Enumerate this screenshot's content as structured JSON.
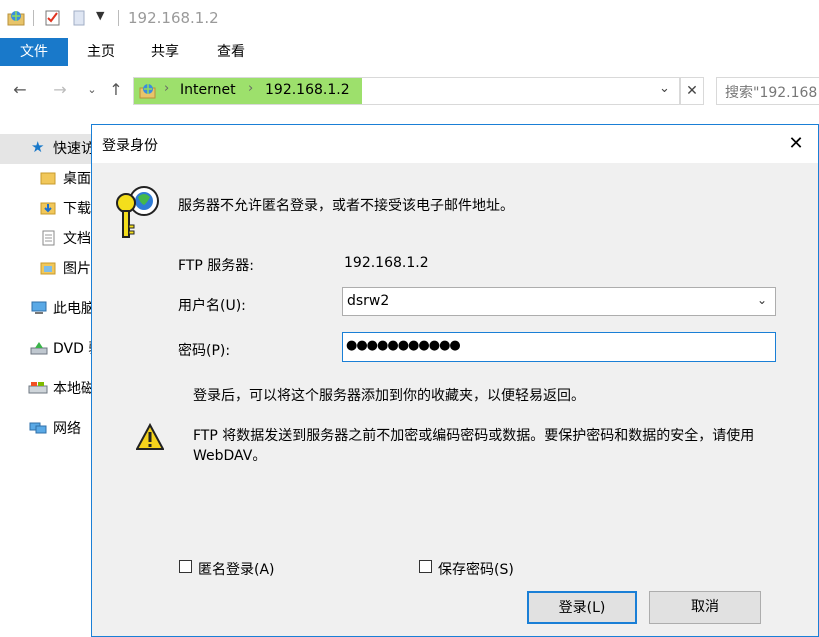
{
  "window": {
    "title": "192.168.1.2",
    "tabs": [
      "文件",
      "主页",
      "共享",
      "查看"
    ]
  },
  "address": {
    "segments": [
      "Internet",
      "192.168.1.2"
    ],
    "close_glyph": "✕",
    "search_placeholder": "搜索\"192.168"
  },
  "sidebar": {
    "items": [
      {
        "label": "快速访",
        "icon": "star-icon"
      },
      {
        "label": "桌面",
        "icon": "folder-icon"
      },
      {
        "label": "下载",
        "icon": "download-folder-icon"
      },
      {
        "label": "文档",
        "icon": "document-icon"
      },
      {
        "label": "图片",
        "icon": "picture-folder-icon"
      },
      {
        "label": "此电脑",
        "icon": "computer-icon"
      },
      {
        "label": "DVD 驱",
        "icon": "dvd-icon"
      },
      {
        "label": "本地磁",
        "icon": "disk-icon"
      },
      {
        "label": "网络",
        "icon": "network-icon"
      }
    ]
  },
  "dialog": {
    "title": "登录身份",
    "close_glyph": "✕",
    "message": "服务器不允许匿名登录，或者不接受该电子邮件地址。",
    "ftp_server_label": "FTP 服务器:",
    "ftp_server_value": "192.168.1.2",
    "username_label": "用户名(U):",
    "username_value": "dsrw2",
    "password_label": "密码(P):",
    "password_value": "●●●●●●●●●●●",
    "info_text": "登录后，可以将这个服务器添加到你的收藏夹，以便轻易返回。",
    "warning_text_line1": "FTP 将数据发送到服务器之前不加密或编码密码或数据。要保护密码和数据的安全，请使用",
    "warning_text_line2": "WebDAV。",
    "anonymous_label": "匿名登录(A)",
    "save_password_label": "保存密码(S)",
    "login_button": "登录(L)",
    "cancel_button": "取消"
  },
  "colors": {
    "accent": "#1979ca",
    "address_highlight": "#9de06c",
    "dialog_border": "#1a7fd6"
  }
}
